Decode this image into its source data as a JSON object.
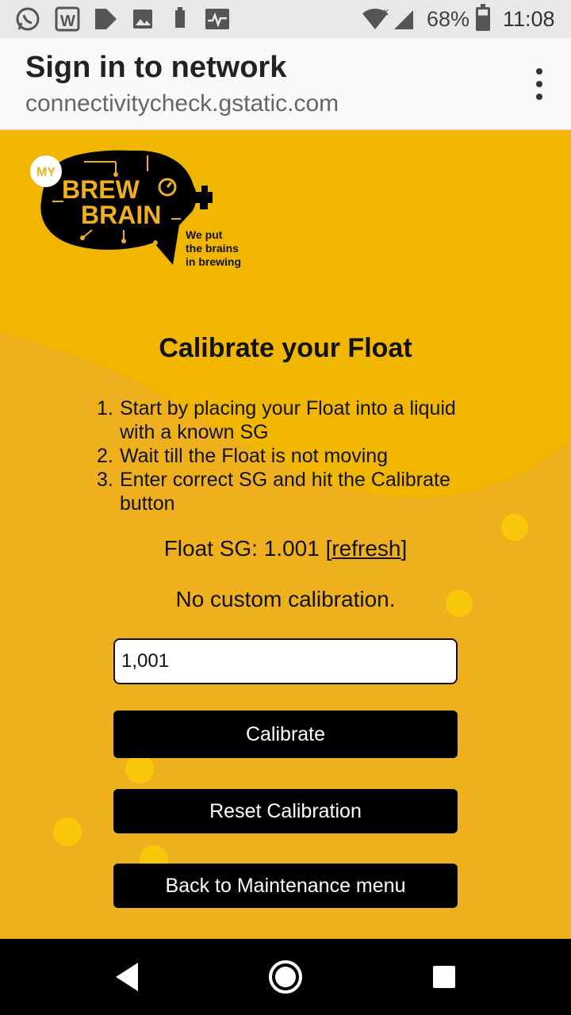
{
  "status_bar": {
    "battery": "68%",
    "time": "11:08",
    "icons": [
      "whatsapp-icon",
      "w-app-icon",
      "play-icon",
      "image-icon",
      "device-icon",
      "activity-icon",
      "wifi-icon",
      "signal-icon",
      "battery-icon"
    ]
  },
  "portal": {
    "title": "Sign in to network",
    "url": "connectivitycheck.gstatic.com"
  },
  "logo": {
    "badge": "MY",
    "line1": "BREW",
    "line2": "BRAIN",
    "tagline1": "We put",
    "tagline2": "the brains",
    "tagline3": "in brewing"
  },
  "main": {
    "heading": "Calibrate your Float",
    "steps": [
      {
        "num": "1.",
        "text": "Start by placing your Float into a liquid with a known SG"
      },
      {
        "num": "2.",
        "text": "Wait till the Float is not moving"
      },
      {
        "num": "3.",
        "text": "Enter correct SG and hit the Calibrate button"
      }
    ],
    "sg_label": "Float SG: 1.001 ",
    "refresh_open": "[",
    "refresh_label": "refresh",
    "refresh_close": "]",
    "calibration_status": "No custom calibration.",
    "sg_input_value": "1,001",
    "calibrate_label": "Calibrate",
    "reset_label": "Reset Calibration",
    "back_label": "Back to Maintenance menu"
  },
  "colors": {
    "background": "#efb01e",
    "accent": "#f9c80a",
    "button": "#000000"
  }
}
